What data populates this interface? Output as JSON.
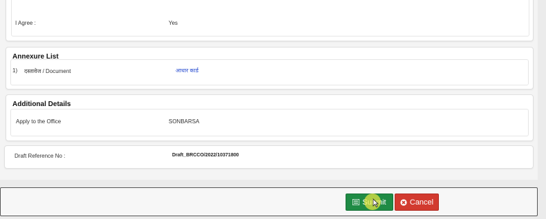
{
  "terms": {
    "label": "I Agree :",
    "value": "Yes"
  },
  "annexure": {
    "title": "Annexure List",
    "row_index": "1)",
    "row_label": "दस्तावेज / Document",
    "row_link": "आधार कार्ड"
  },
  "additional": {
    "title": "Additional Details",
    "label": "Apply to the Office",
    "value": "SONBARSA"
  },
  "draft": {
    "label": "Draft Reference No :",
    "value": "Draft_BRCCO/2022/10371800"
  },
  "actions": {
    "submit_label": "Submit",
    "cancel_label": "Cancel"
  },
  "colors": {
    "submit": "#1f8b45",
    "cancel": "#d23a2f",
    "link": "#2a4ed0"
  }
}
